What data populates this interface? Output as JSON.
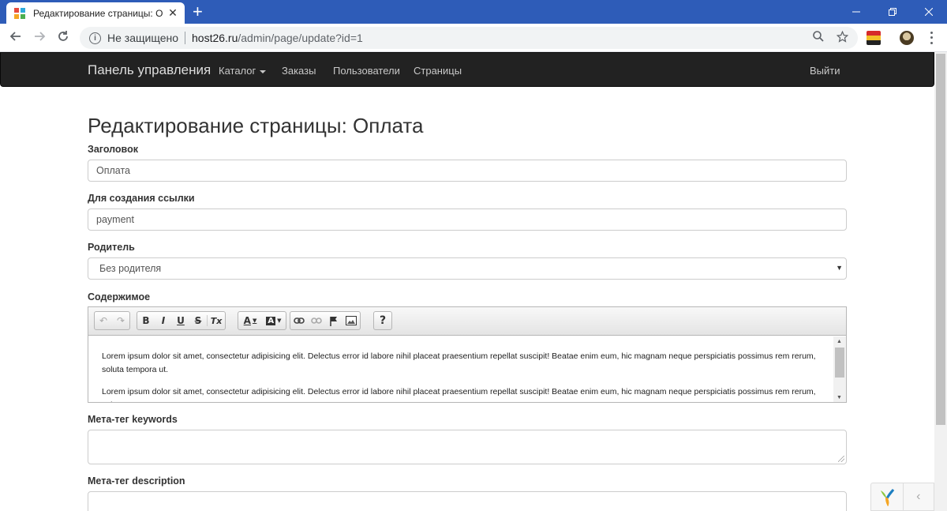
{
  "browser": {
    "tab_title": "Редактирование страницы: Опл",
    "tab_close": "✕",
    "new_tab": "+",
    "security_text": "Не защищено",
    "url_host": "host26.ru",
    "url_path": "/admin/page/update?id=1",
    "icons": [
      "back-icon",
      "forward-icon",
      "reload-icon",
      "info-icon",
      "zoom-icon",
      "star-icon",
      "extension-flag-icon",
      "profile-avatar-icon",
      "menu-icon"
    ]
  },
  "navbar": {
    "brand": "Панель управления",
    "items": [
      {
        "label": "Каталог"
      },
      {
        "label": "Заказы"
      },
      {
        "label": "Пользователи"
      },
      {
        "label": "Страницы"
      }
    ],
    "logout": "Выйти"
  },
  "page": {
    "title": "Редактирование страницы: Оплата"
  },
  "form": {
    "title_label": "Заголовок",
    "title_value": "Оплата",
    "slug_label": "Для создания ссылки",
    "slug_value": "payment",
    "parent_label": "Родитель",
    "parent_value": "Без родителя",
    "content_label": "Содержимое",
    "content_paragraphs": [
      "Lorem ipsum dolor sit amet, consectetur adipisicing elit. Delectus error id labore nihil placeat praesentium repellat suscipit! Beatae enim eum, hic magnam neque perspiciatis possimus rem rerum, soluta tempora ut.",
      "Lorem ipsum dolor sit amet, consectetur adipisicing elit. Delectus error id labore nihil placeat praesentium repellat suscipit! Beatae enim eum, hic magnam neque perspiciatis possimus rem rerum, soluta tempora ut."
    ],
    "keywords_label": "Мета-тег keywords",
    "keywords_value": "",
    "description_label": "Мета-тег description",
    "description_value": ""
  },
  "editor_toolbar": {
    "undo": "↶",
    "redo": "↷",
    "bold": "B",
    "italic": "I",
    "underline": "U",
    "strike": "S",
    "remove_format": "Tx",
    "text_color": "A",
    "bg_color": "A",
    "help": "?"
  },
  "colors": {
    "navbar_bg": "#222222",
    "tabbar_bg": "#2e5cb8"
  }
}
